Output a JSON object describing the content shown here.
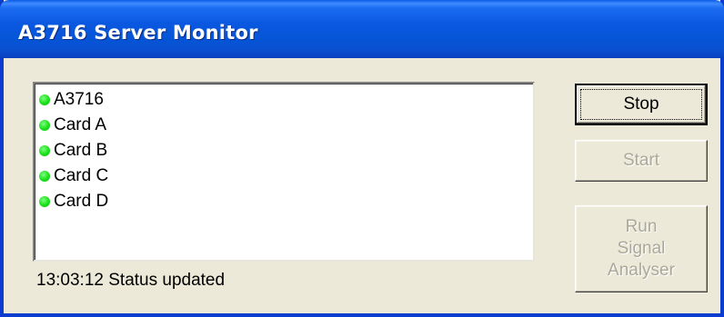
{
  "window": {
    "title": "A3716 Server Monitor"
  },
  "list": {
    "items": [
      {
        "label": "A3716",
        "status_color": "#19e019"
      },
      {
        "label": "Card A",
        "status_color": "#19e019"
      },
      {
        "label": "Card B",
        "status_color": "#19e019"
      },
      {
        "label": "Card C",
        "status_color": "#19e019"
      },
      {
        "label": "Card D",
        "status_color": "#19e019"
      }
    ]
  },
  "status_text": "13:03:12 Status updated",
  "buttons": {
    "stop": {
      "label": "Stop",
      "enabled": true
    },
    "start": {
      "label": "Start",
      "enabled": false
    },
    "run_signal_analyser": {
      "lines": [
        "Run",
        "Signal",
        "Analyser"
      ],
      "enabled": false
    }
  },
  "colors": {
    "titlebar": "#0a58e0",
    "window_face": "#ece9d8",
    "disabled_text": "#aca899",
    "status_ok": "#19e019"
  }
}
